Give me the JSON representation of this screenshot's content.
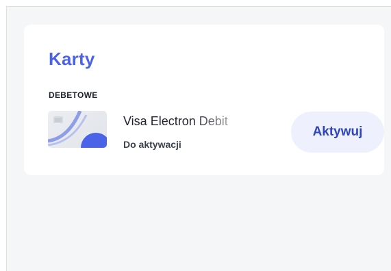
{
  "cards_panel": {
    "title": "Karty",
    "section_label": "DEBETOWE",
    "card": {
      "name": "Visa Electron Debit",
      "status": "Do aktywacji",
      "action_label": "Aktywuj",
      "icon": "card-thumbnail-icon"
    }
  },
  "colors": {
    "accent": "#4b63e6",
    "button_bg": "#eef0fd",
    "button_text": "#2f46b8",
    "text_primary": "#1f2330",
    "background": "#f5f6f8"
  }
}
